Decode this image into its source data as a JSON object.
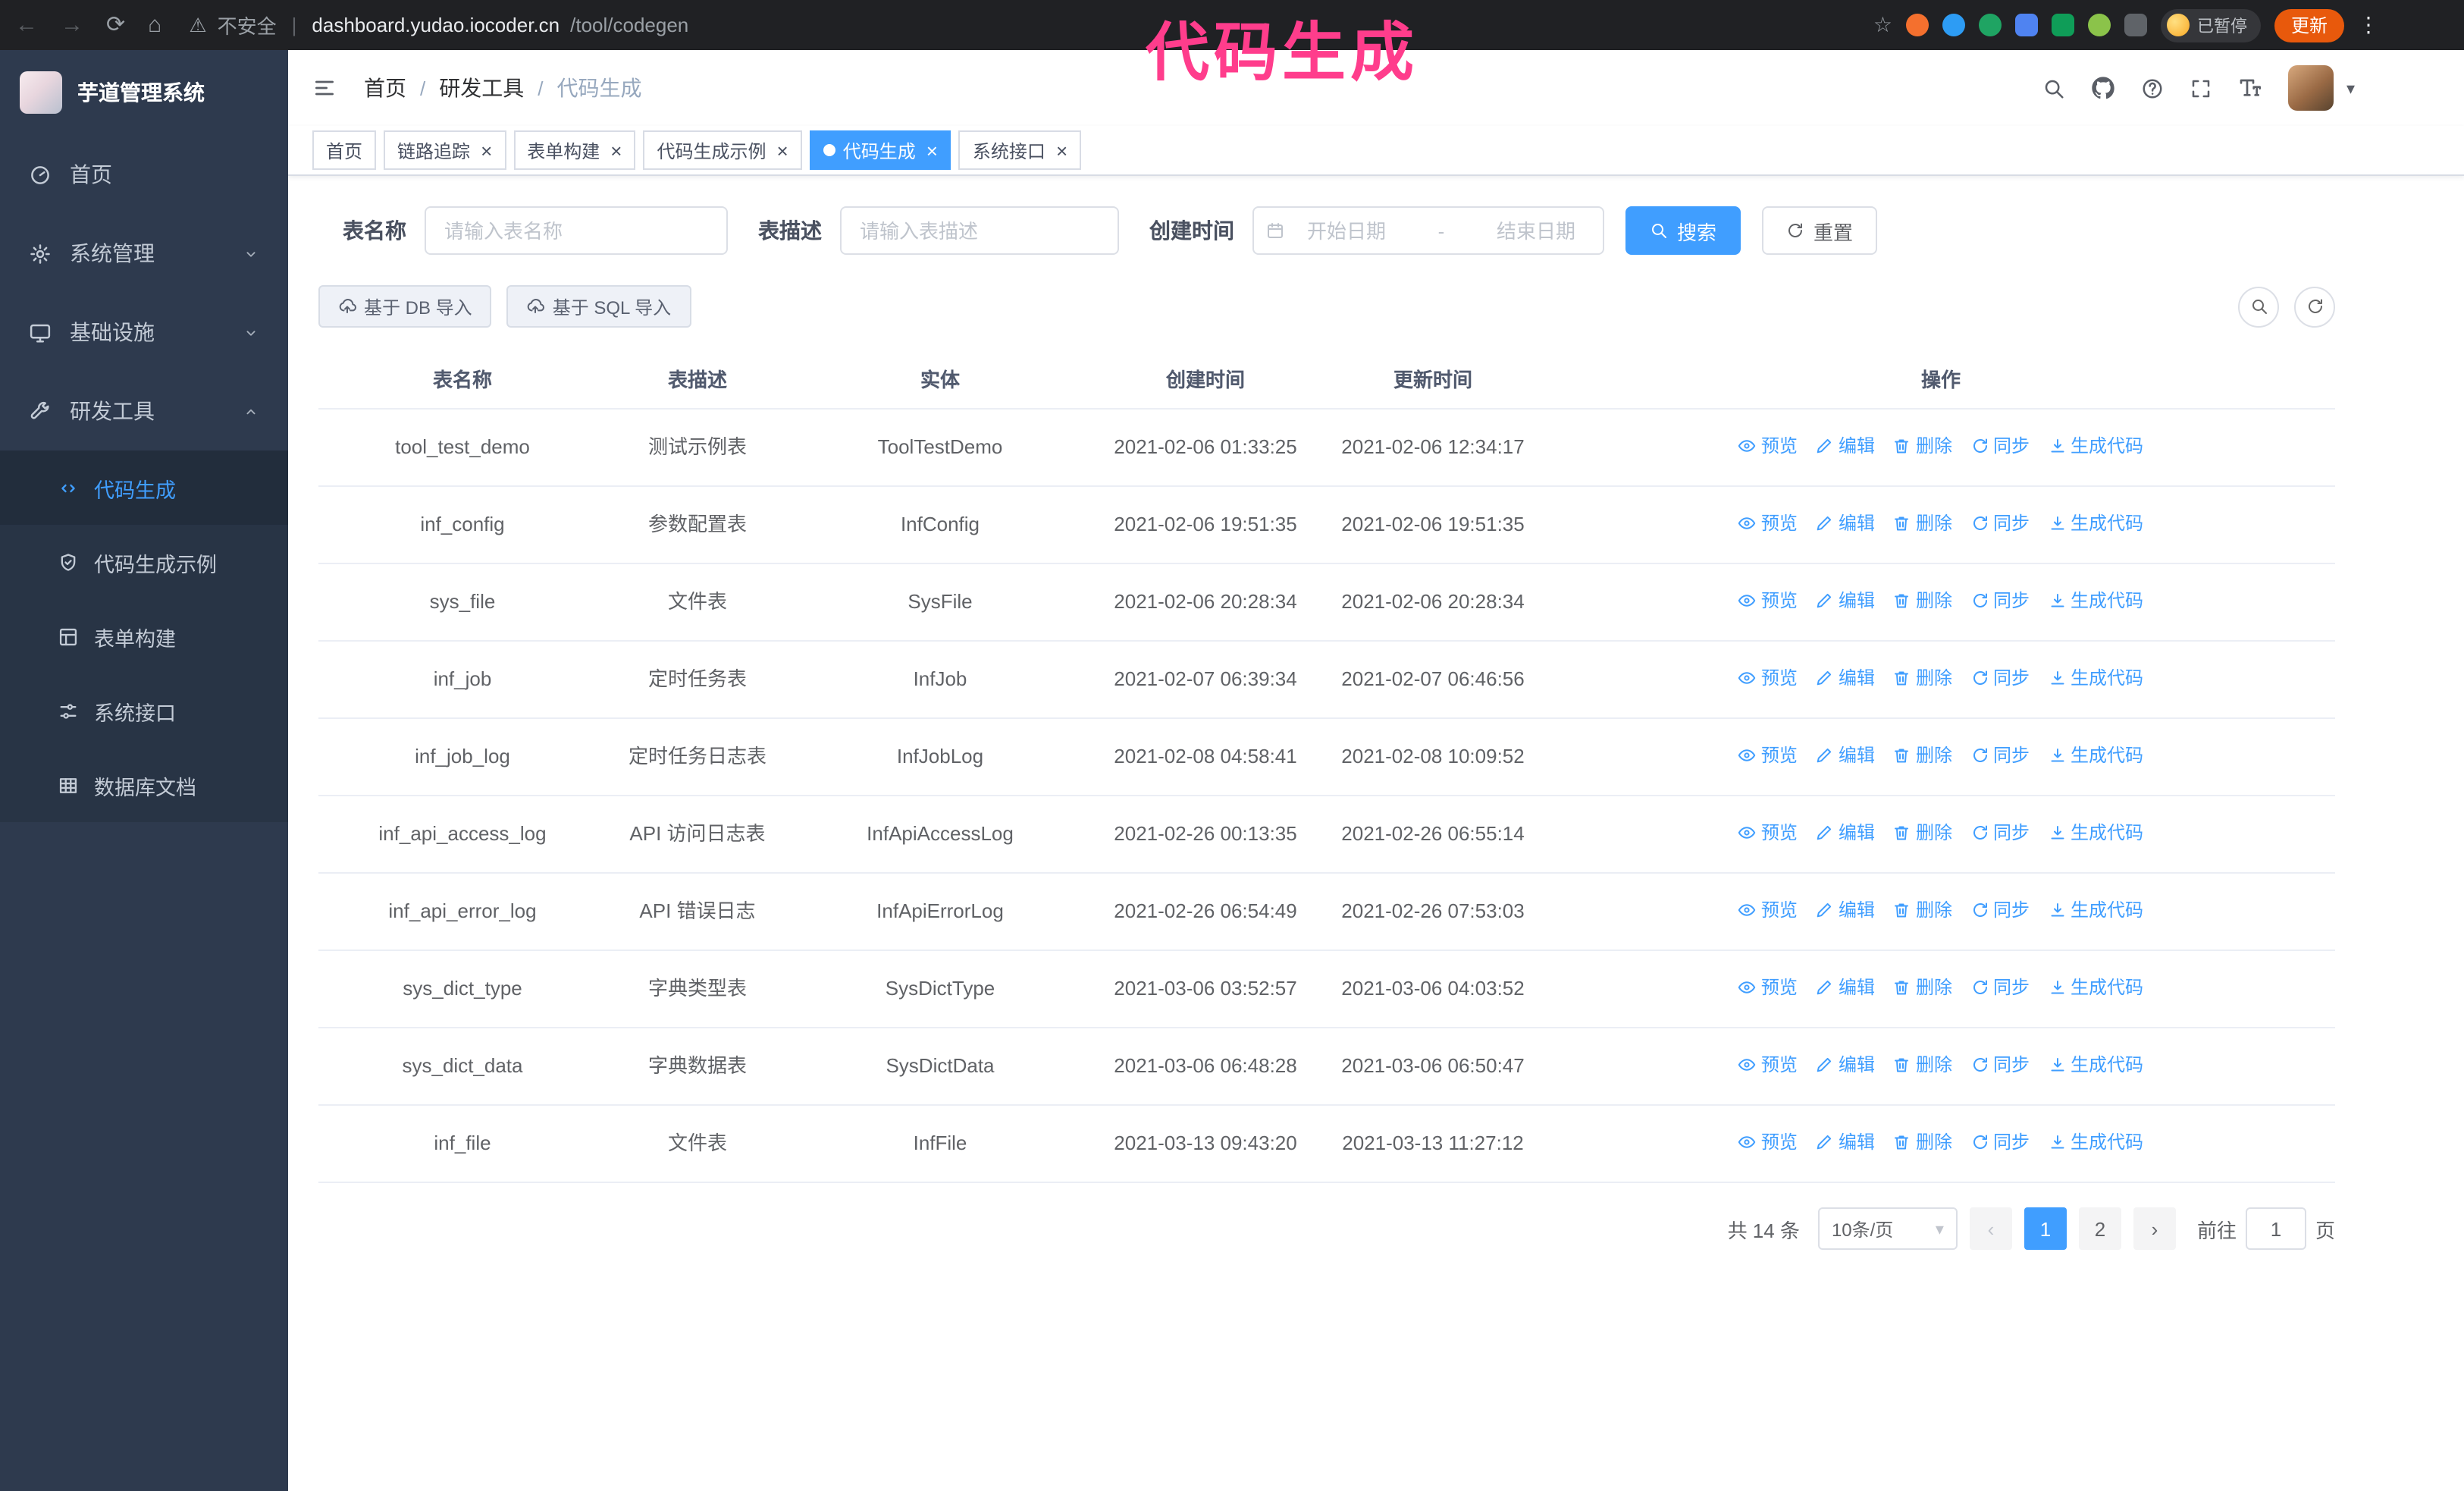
{
  "colors": {
    "primary": "#409eff",
    "annotation_pink": "#ff3d8c",
    "sidebar_bg": "#2e3a4e"
  },
  "icons": {
    "back": "←",
    "forward": "→",
    "reload": "⟳",
    "home": "⌂",
    "warning": "⚠",
    "star": "☆",
    "kebab": "⋮",
    "close": "×",
    "caret_down": "▾",
    "prev": "‹",
    "next": "›"
  },
  "browser": {
    "security_label": "不安全",
    "url_domain": "dashboard.yudao.iocoder.cn",
    "url_path": "/tool/codegen",
    "paused_badge": "已暂停",
    "update_button": "更新"
  },
  "overlay": {
    "title": "代码生成"
  },
  "sidebar": {
    "app_title": "芋道管理系统",
    "items": [
      {
        "label": "首页"
      },
      {
        "label": "系统管理"
      },
      {
        "label": "基础设施"
      },
      {
        "label": "研发工具"
      }
    ],
    "subitems": [
      {
        "label": "代码生成"
      },
      {
        "label": "代码生成示例"
      },
      {
        "label": "表单构建"
      },
      {
        "label": "系统接口"
      },
      {
        "label": "数据库文档"
      }
    ]
  },
  "header": {
    "breadcrumb": [
      "首页",
      "研发工具",
      "代码生成"
    ]
  },
  "tabs": [
    {
      "label": "首页"
    },
    {
      "label": "链路追踪"
    },
    {
      "label": "表单构建"
    },
    {
      "label": "代码生成示例"
    },
    {
      "label": "代码生成"
    },
    {
      "label": "系统接口"
    }
  ],
  "filters": {
    "table_name_label": "表名称",
    "table_name_placeholder": "请输入表名称",
    "table_desc_label": "表描述",
    "table_desc_placeholder": "请输入表描述",
    "create_time_label": "创建时间",
    "date_start_placeholder": "开始日期",
    "date_separator": "-",
    "date_end_placeholder": "结束日期",
    "search_button": "搜索",
    "reset_button": "重置"
  },
  "toolbar": {
    "import_db": "基于 DB 导入",
    "import_sql": "基于 SQL 导入"
  },
  "table": {
    "columns": [
      "表名称",
      "表描述",
      "实体",
      "创建时间",
      "更新时间",
      "操作"
    ],
    "ops": {
      "preview": "预览",
      "edit": "编辑",
      "delete": "删除",
      "sync": "同步",
      "generate": "生成代码"
    },
    "rows": [
      {
        "name": "tool_test_demo",
        "desc": "测试示例表",
        "entity": "ToolTestDemo",
        "created": "2021-02-06 01:33:25",
        "updated": "2021-02-06 12:34:17"
      },
      {
        "name": "inf_config",
        "desc": "参数配置表",
        "entity": "InfConfig",
        "created": "2021-02-06 19:51:35",
        "updated": "2021-02-06 19:51:35"
      },
      {
        "name": "sys_file",
        "desc": "文件表",
        "entity": "SysFile",
        "created": "2021-02-06 20:28:34",
        "updated": "2021-02-06 20:28:34"
      },
      {
        "name": "inf_job",
        "desc": "定时任务表",
        "entity": "InfJob",
        "created": "2021-02-07 06:39:34",
        "updated": "2021-02-07 06:46:56"
      },
      {
        "name": "inf_job_log",
        "desc": "定时任务日志表",
        "entity": "InfJobLog",
        "created": "2021-02-08 04:58:41",
        "updated": "2021-02-08 10:09:52"
      },
      {
        "name": "inf_api_access_log",
        "desc": "API 访问日志表",
        "entity": "InfApiAccessLog",
        "created": "2021-02-26 00:13:35",
        "updated": "2021-02-26 06:55:14"
      },
      {
        "name": "inf_api_error_log",
        "desc": "API 错误日志",
        "entity": "InfApiErrorLog",
        "created": "2021-02-26 06:54:49",
        "updated": "2021-02-26 07:53:03"
      },
      {
        "name": "sys_dict_type",
        "desc": "字典类型表",
        "entity": "SysDictType",
        "created": "2021-03-06 03:52:57",
        "updated": "2021-03-06 04:03:52"
      },
      {
        "name": "sys_dict_data",
        "desc": "字典数据表",
        "entity": "SysDictData",
        "created": "2021-03-06 06:48:28",
        "updated": "2021-03-06 06:50:47"
      },
      {
        "name": "inf_file",
        "desc": "文件表",
        "entity": "InfFile",
        "created": "2021-03-13 09:43:20",
        "updated": "2021-03-13 11:27:12"
      }
    ]
  },
  "pagination": {
    "total": "共 14 条",
    "page_size": "10条/页",
    "pages": [
      "1",
      "2"
    ],
    "goto_label": "前往",
    "goto_value": "1",
    "goto_suffix": "页"
  }
}
